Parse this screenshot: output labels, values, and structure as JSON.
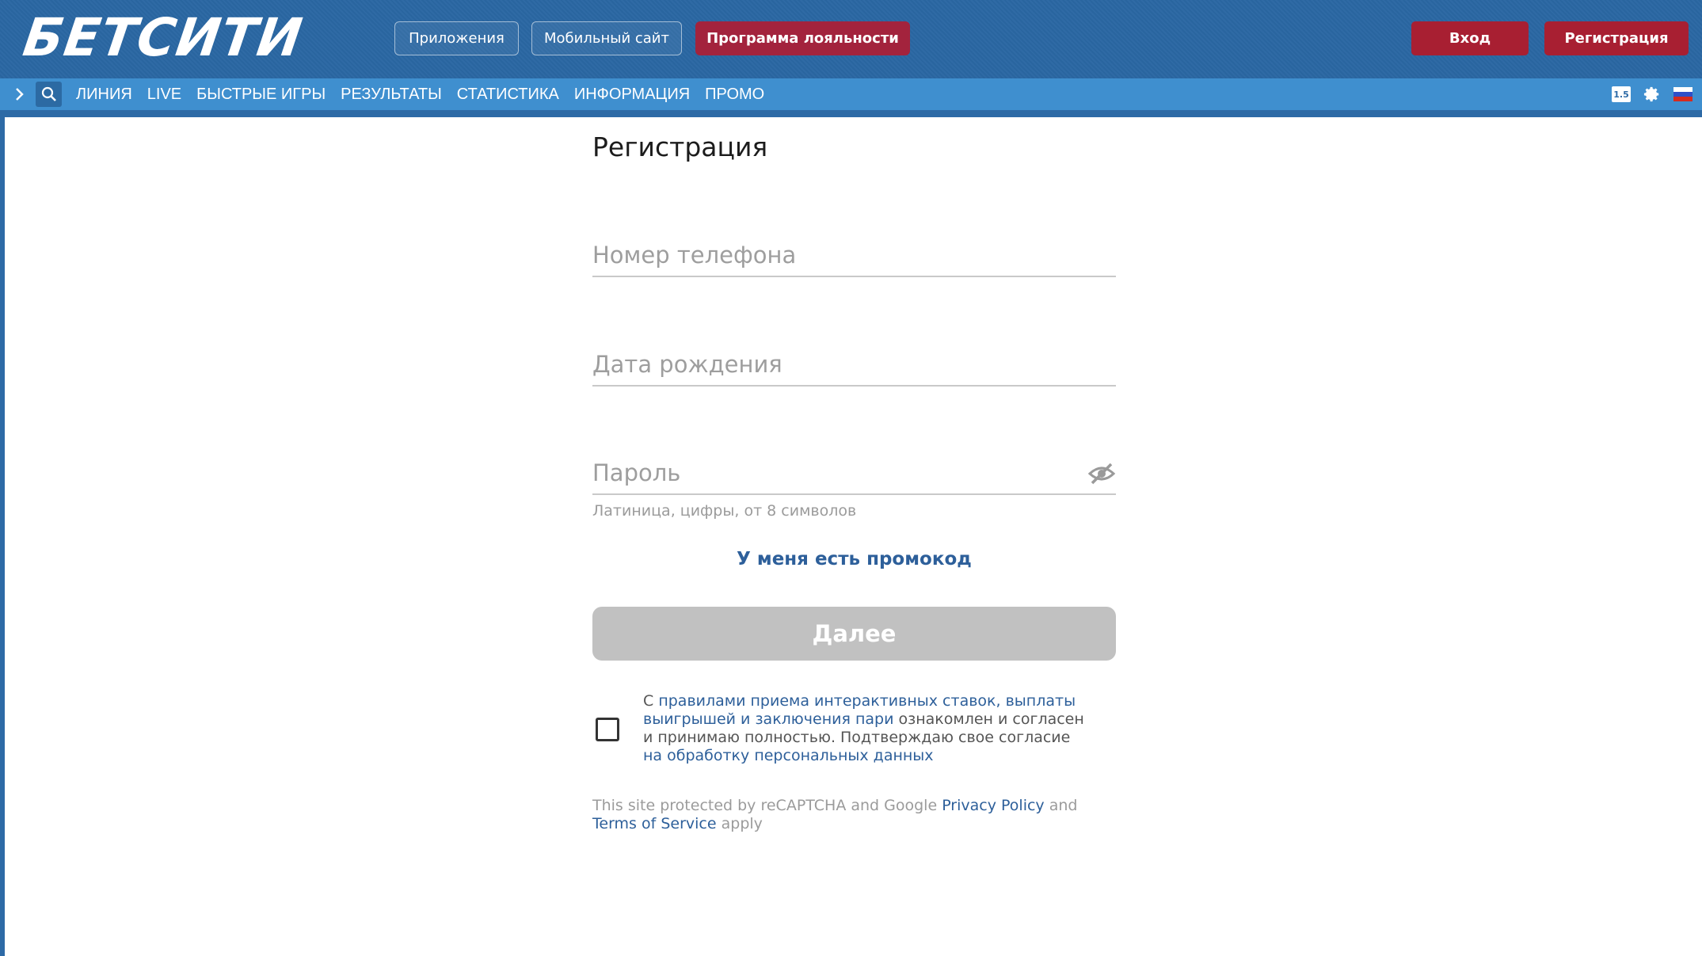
{
  "header": {
    "logo": "БЕТСИТИ",
    "apps_label": "Приложения",
    "mobile_label": "Мобильный сайт",
    "loyalty_label": "Программа лояльности",
    "login_label": "Вход",
    "register_label": "Регистрация"
  },
  "nav": {
    "items": [
      "ЛИНИЯ",
      "LIVE",
      "БЫСТРЫЕ ИГРЫ",
      "РЕЗУЛЬТАТЫ",
      "СТАТИСТИКА",
      "ИНФОРМАЦИЯ",
      "ПРОМО"
    ],
    "coef_badge": "1.5",
    "icons": [
      "chevron-right-icon",
      "search-icon",
      "coefficient-icon",
      "gear-icon",
      "russian-flag-icon"
    ]
  },
  "form": {
    "title": "Регистрация",
    "phone_placeholder": "Номер телефона",
    "dob_placeholder": "Дата рождения",
    "password_placeholder": "Пароль",
    "password_hint": "Латиница, цифры, от 8 символов",
    "promo_link": "У меня есть промокод",
    "next_button": "Далее",
    "terms": {
      "prefix": "С ",
      "rules_link": "правилами приема интерактивных ставок, выплаты выигрышей и заключения пари",
      "middle": " ознакомлен и согласен и принимаю полностью. Подтверждаю свое согласие ",
      "personal_link": "на обработку персональных данных"
    },
    "captcha": {
      "prefix": "This site protected by reCAPTCHA and Google ",
      "privacy_link": "Privacy Policy",
      "and": " and ",
      "tos_link": "Terms of Service",
      "suffix": " apply"
    }
  },
  "colors": {
    "header_bg": "#2a67a3",
    "nav_bg": "#3f8fcf",
    "accent_red": "#a81f32",
    "link_blue": "#2d5f9a",
    "disabled_button": "#c1c1c1"
  }
}
